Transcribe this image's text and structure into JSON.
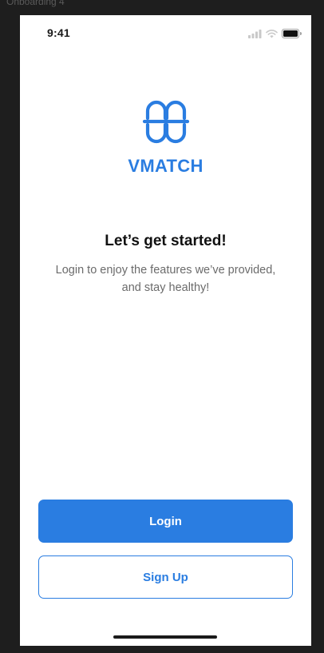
{
  "frame": {
    "label": "Onboarding 4"
  },
  "status_bar": {
    "time": "9:41",
    "icons": [
      "signal-icon",
      "wifi-icon",
      "battery-icon"
    ]
  },
  "brand": {
    "name": "VMATCH",
    "logo_icon": "vmatch-logo-icon",
    "color": "#2a7de1"
  },
  "onboarding": {
    "title": "Let’s get started!",
    "description": "Login to enjoy the features we’ve provided, and stay healthy!"
  },
  "actions": {
    "login_label": "Login",
    "signup_label": "Sign Up"
  },
  "colors": {
    "accent": "#2a7de1",
    "background": "#ffffff",
    "canvas": "#1e1e1e"
  }
}
